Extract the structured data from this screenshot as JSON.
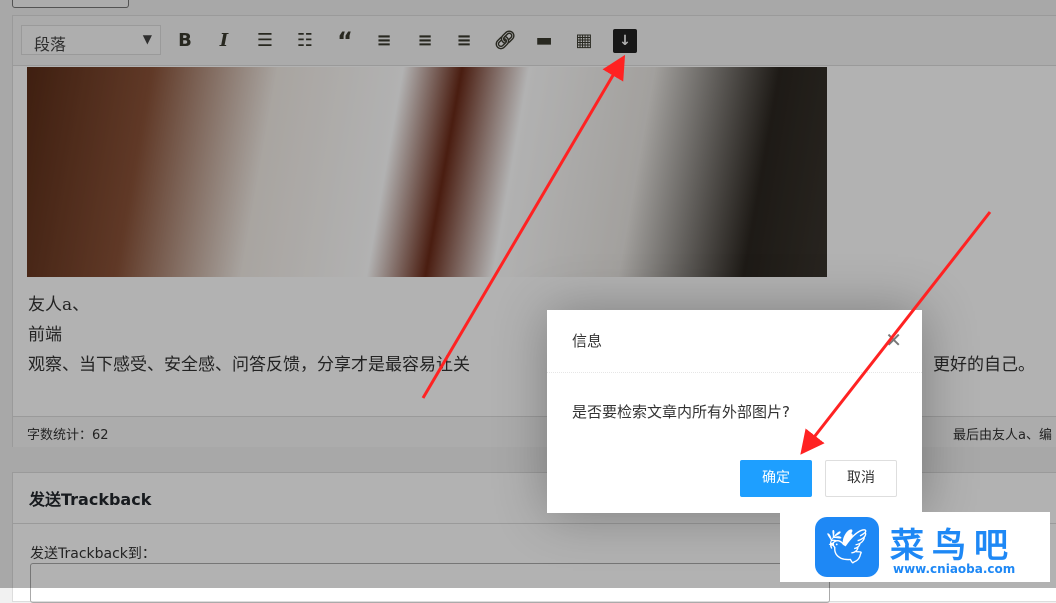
{
  "toolbar": {
    "format_select": "段落",
    "icons": [
      "bold-icon",
      "italic-icon",
      "bullet-list-icon",
      "numbered-list-icon",
      "blockquote-icon",
      "align-left-icon",
      "align-center-icon",
      "align-right-icon",
      "link-icon",
      "read-more-icon",
      "toolbar-toggle-icon",
      "download-images-icon"
    ]
  },
  "content": {
    "line1": "友人a、",
    "line2": "前端",
    "line3": "观察、当下感受、安全感、问答反馈，分享才是最容易让关",
    "line3_end": "更好的自己。"
  },
  "status": {
    "word_count": "字数统计：62",
    "last_edit": "最后由友人a、编"
  },
  "trackback": {
    "title": "发送Trackback",
    "label": "发送Trackback到："
  },
  "dialog": {
    "title": "信息",
    "message": "是否要检索文章内所有外部图片?",
    "confirm": "确定",
    "cancel": "取消"
  },
  "watermark": {
    "name": "菜鸟吧",
    "url": "www.cniaoba.com"
  }
}
